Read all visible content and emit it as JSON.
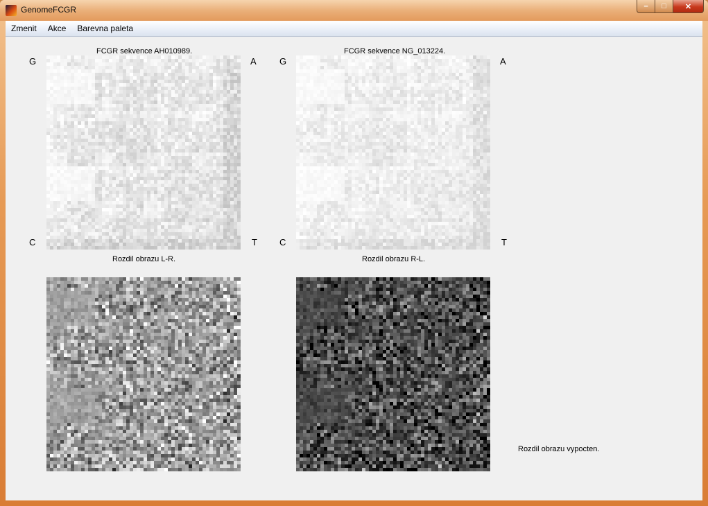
{
  "window": {
    "title": "GenomeFCGR",
    "controls": {
      "minimize": "–",
      "maximize": "□",
      "close": "✕"
    }
  },
  "menu": [
    "Zmenit",
    "Akce",
    "Barevna paleta"
  ],
  "panels": {
    "left_top_title": "FCGR sekvence AH010989.",
    "right_top_title": "FCGR sekvence NG_013224.",
    "left_bottom_title": "Rozdil obrazu L-R.",
    "right_bottom_title": "Rozdil obrazu R-L."
  },
  "corners": {
    "left": {
      "tl": "G",
      "tr": "A",
      "bl": "C",
      "br": "T"
    },
    "right": {
      "tl": "G",
      "tr": "A",
      "bl": "C",
      "br": "T"
    }
  },
  "status": "Rozdil obrazu vypocten.",
  "colors": {
    "window_frame": "#e39a5c",
    "content_bg": "#f0f0f0"
  }
}
